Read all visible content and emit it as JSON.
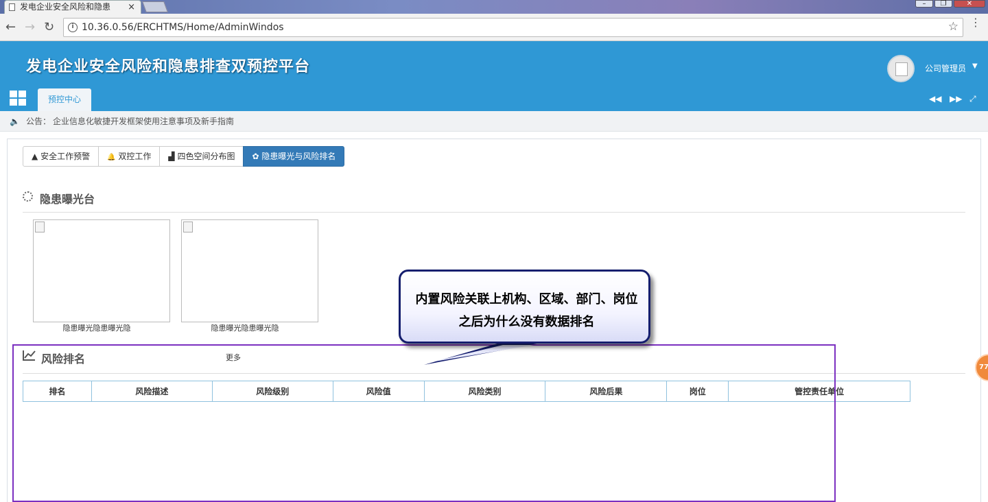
{
  "browser": {
    "tab_title": "发电企业安全风险和隐患",
    "tab_close": "×",
    "window_controls": [
      "–",
      "❐",
      "✕"
    ],
    "url": "10.36.0.56/ERCHTMS/Home/AdminWindos",
    "nav_back": "←",
    "nav_forward": "→",
    "nav_reload": "↻",
    "info": "i",
    "star": "☆",
    "menu": "⋮"
  },
  "header": {
    "title": "发电企业安全风险和隐患排查双预控平台",
    "user_name": "公司管理员",
    "user_caret": "▼",
    "module_tab": "预控中心",
    "controls": [
      "◀◀",
      "▶▶",
      "⤢"
    ]
  },
  "notice": {
    "speaker": "🔈",
    "label": "公告：",
    "text": "企业信息化敏捷开发框架使用注意事项及新手指南"
  },
  "tabs": [
    {
      "icon": "▲",
      "label": "安全工作预警"
    },
    {
      "icon": "🔔",
      "label": "双控工作"
    },
    {
      "icon": "▟",
      "label": "四色空间分布图"
    },
    {
      "icon": "✿",
      "label": "隐患曝光与风险排名"
    }
  ],
  "exposure": {
    "title": "隐患曝光台",
    "cards": [
      {
        "caption": "隐患曝光隐患曝光隐"
      },
      {
        "caption": "隐患曝光隐患曝光隐"
      }
    ]
  },
  "ranking": {
    "title": "风险排名",
    "more": "更多",
    "columns": [
      "排名",
      "风险描述",
      "风险级别",
      "风险值",
      "风险类别",
      "风险后果",
      "岗位",
      "管控责任单位"
    ]
  },
  "callout": {
    "line1": "内置风险关联上机构、区域、部门、岗位",
    "line2": "之后为什么没有数据排名"
  },
  "float_badge": "77",
  "colors": {
    "header": "#2f98d5",
    "active_tab": "#337ab7",
    "annotation_box": "#7b2fc0",
    "callout_border": "#151e6e",
    "float_badge": "#f08a3c"
  }
}
